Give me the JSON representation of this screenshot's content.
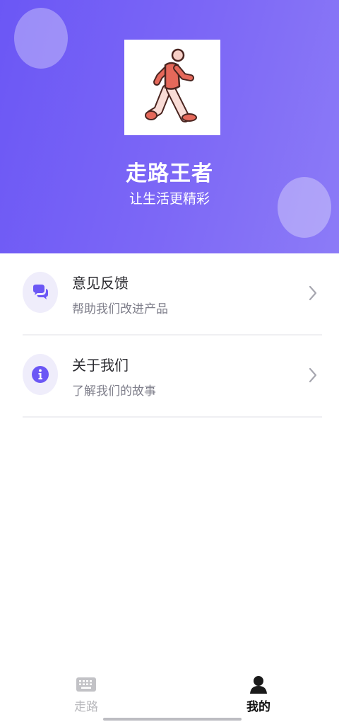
{
  "profile": {
    "app_name": "走路王者",
    "slogan": "让生活更精彩",
    "logo_icon": "walking-person-icon"
  },
  "menu": {
    "items": [
      {
        "title": "意见反馈",
        "description": "帮助我们改进产品",
        "icon": "chat-bubbles-icon"
      },
      {
        "title": "关于我们",
        "description": "了解我们的故事",
        "icon": "info-icon"
      }
    ]
  },
  "tabbar": {
    "tabs": [
      {
        "label": "走路",
        "icon": "keyboard-icon",
        "active": false
      },
      {
        "label": "我的",
        "icon": "person-icon",
        "active": true
      }
    ]
  },
  "colors": {
    "accent": "#6b57f5",
    "accent_light": "#8c7bf7",
    "icon_bg": "#efedfb",
    "active_tab": "#111111",
    "inactive_tab": "#b8b8bc"
  }
}
